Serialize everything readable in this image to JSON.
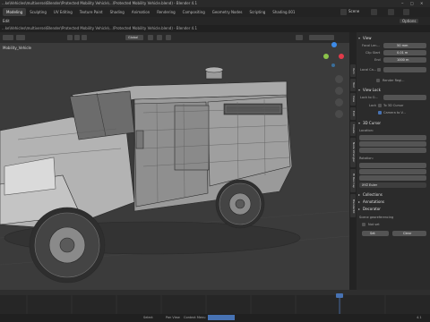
{
  "titlebar": {
    "text": "...ke\\Vehicles\\multiverse\\Blender\\Protected Mobility Vehicle\\...\\Protected Mobility Vehicle.blend) - Blender 4.1"
  },
  "menubar": {
    "tabs": [
      {
        "label": "Modeling",
        "active": true
      },
      {
        "label": "Sculpting",
        "active": false
      },
      {
        "label": "UV Editing",
        "active": false
      },
      {
        "label": "Texture Paint",
        "active": false
      },
      {
        "label": "Shading",
        "active": false
      },
      {
        "label": "Animation",
        "active": false
      },
      {
        "label": "Rendering",
        "active": false
      },
      {
        "label": "Compositing",
        "active": false
      },
      {
        "label": "Geometry Nodes",
        "active": false
      },
      {
        "label": "Scripting",
        "active": false
      },
      {
        "label": "Shading.001",
        "active": false
      }
    ],
    "scene_label": "Scene"
  },
  "toprow": {
    "options_label": "Options",
    "left_label": "Edit"
  },
  "viewport": {
    "object_label": "Mobility_Vehicle",
    "global_label": "Global",
    "colors": {
      "bg": "#3b3b3b",
      "x_axis": "#e23b4a",
      "y_axis": "#8bc34a",
      "z_axis": "#3d8be8"
    }
  },
  "sidetabs": [
    "Item",
    "Tool",
    "View",
    "Edit",
    "Create",
    "Node Wrangler",
    "Hi Res Cap",
    "BlenderKit"
  ],
  "properties": {
    "view": {
      "title": "View",
      "focal_label": "Focal Len...",
      "focal_value": "50 mm",
      "clip_start_label": "Clip Start",
      "clip_start_value": "0.01 m",
      "end_label": "End",
      "end_value": "1000 m",
      "local_camera_label": "Local Ca...",
      "render_region_label": "Render Regi..."
    },
    "view_lock": {
      "title": "View Lock",
      "lock_to_object_label": "Lock to O...",
      "lock_label": "Lock",
      "to_3d_cursor_label": "To 3D Cursor",
      "camera_to_view_label": "Camera to V..."
    },
    "cursor": {
      "title": "3D Cursor",
      "location_label": "Location:",
      "rotation_label": "Rotation:",
      "rotation_mode": "XYZ Euler"
    },
    "collections_title": "Collections",
    "annotations_title": "Annotations",
    "decorator_title": "Decorator",
    "scene_georef_label": "Scene georeferencing",
    "not_set_label": "Not set",
    "set_geo_label": "Set",
    "clear_label": "Clear",
    "accent_color": "#4772b3"
  },
  "statusbar": {
    "items": [
      "Select",
      "Pan View",
      "Context Menu"
    ],
    "version_label": "4.1"
  }
}
